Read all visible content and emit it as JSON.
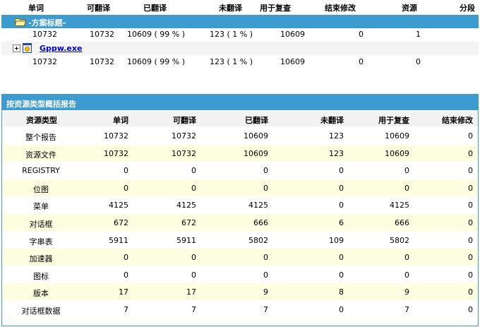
{
  "summary": {
    "headers": [
      "单词",
      "可翻译",
      "已翻译",
      "未翻译",
      "用于复查",
      "结束修改",
      "资源",
      "分段"
    ],
    "project": {
      "title": "-方案标题-",
      "values": [
        "10732",
        "10732",
        "10609 ( 99 % )",
        "123 ( 1 % )",
        "10609",
        "0",
        "1"
      ]
    },
    "file": {
      "name": "Gppw.exe",
      "values": [
        "10732",
        "10732",
        "10609 ( 99 % )",
        "123 ( 1 % )",
        "10609",
        "0",
        "0"
      ]
    }
  },
  "report": {
    "title": "按资源类型概括报告",
    "headers": [
      "资源类型",
      "单词",
      "可翻译",
      "已翻译",
      "未翻译",
      "用于复查",
      "结束修改"
    ],
    "rows": [
      [
        "整个报告",
        "10732",
        "10732",
        "10609",
        "123",
        "10609",
        "0"
      ],
      [
        "资源文件",
        "10732",
        "10732",
        "10609",
        "123",
        "10609",
        "0"
      ],
      [
        "REGISTRY",
        "0",
        "0",
        "0",
        "0",
        "0",
        "0"
      ],
      [
        "位图",
        "0",
        "0",
        "0",
        "0",
        "0",
        "0"
      ],
      [
        "菜单",
        "4125",
        "4125",
        "4125",
        "0",
        "4125",
        "0"
      ],
      [
        "对话框",
        "672",
        "672",
        "666",
        "6",
        "666",
        "0"
      ],
      [
        "字串表",
        "5911",
        "5911",
        "5802",
        "109",
        "5802",
        "0"
      ],
      [
        "加速器",
        "0",
        "0",
        "0",
        "0",
        "0",
        "0"
      ],
      [
        "图标",
        "0",
        "0",
        "0",
        "0",
        "0",
        "0"
      ],
      [
        "版本",
        "17",
        "17",
        "9",
        "8",
        "9",
        "0"
      ],
      [
        "对话框数据",
        "7",
        "7",
        "7",
        "0",
        "7",
        "0"
      ]
    ]
  }
}
